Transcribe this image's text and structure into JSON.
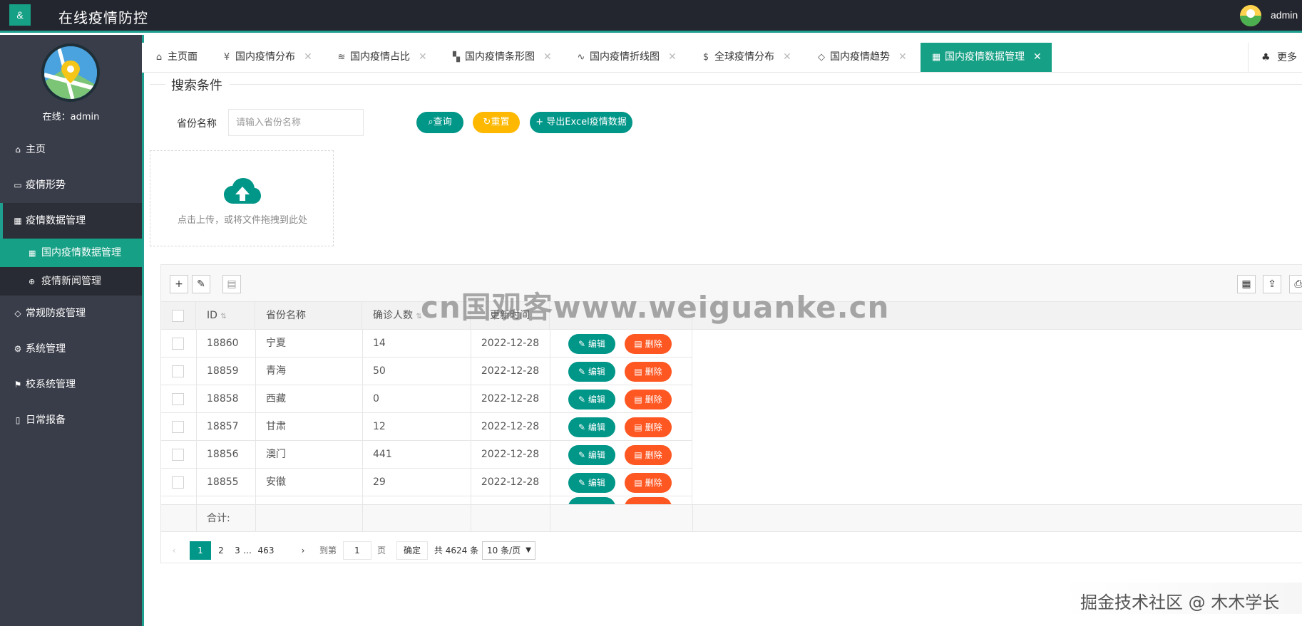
{
  "header": {
    "logo": "&",
    "title": "在线疫情防控",
    "user": "admin"
  },
  "sidebar": {
    "online_text": "在线：admin",
    "items": [
      {
        "icon": "home-icon",
        "glyph": "⌂",
        "label": "主页"
      },
      {
        "icon": "monitor-icon",
        "glyph": "▭",
        "label": "疫情形势"
      },
      {
        "icon": "table-icon",
        "glyph": "▦",
        "label": "疫情数据管理"
      },
      {
        "icon": "shield-icon",
        "glyph": "◇",
        "label": "常规防疫管理"
      },
      {
        "icon": "gear-icon",
        "glyph": "⚙",
        "label": "系统管理"
      },
      {
        "icon": "flag-icon",
        "glyph": "⚑",
        "label": "校系统管理"
      },
      {
        "icon": "book-icon",
        "glyph": "▯",
        "label": "日常报备"
      }
    ],
    "sub_items": [
      {
        "icon": "table-icon",
        "glyph": "▦",
        "label": "国内疫情数据管理"
      },
      {
        "icon": "globe-icon",
        "glyph": "⊕",
        "label": "疫情新闻管理"
      }
    ]
  },
  "tabs": [
    {
      "icon": "home-icon",
      "glyph": "⌂",
      "label": "主页面"
    },
    {
      "icon": "yen-icon",
      "glyph": "¥",
      "label": "国内疫情分布"
    },
    {
      "icon": "layers-icon",
      "glyph": "≋",
      "label": "国内疫情占比"
    },
    {
      "icon": "app-icon",
      "glyph": "▚",
      "label": "国内疫情条形图"
    },
    {
      "icon": "pulse-icon",
      "glyph": "∿",
      "label": "国内疫情折线图"
    },
    {
      "icon": "dollar-icon",
      "glyph": "$",
      "label": "全球疫情分布"
    },
    {
      "icon": "diamond-icon",
      "glyph": "◇",
      "label": "国内疫情趋势"
    },
    {
      "icon": "table-icon",
      "glyph": "▦",
      "label": "国内疫情数据管理"
    }
  ],
  "tab_more": "更多",
  "search": {
    "legend": "搜索条件",
    "field_label": "省份名称",
    "placeholder": "请输入省份名称",
    "query_label": "查询",
    "reset_label": "重置",
    "export_label": "导出Excel疫情数据"
  },
  "upload": {
    "text": "点击上传，或将文件拖拽到此处"
  },
  "table": {
    "headers": {
      "id": "ID",
      "province": "省份名称",
      "confirmed": "确诊人数",
      "updated": "更新时间"
    },
    "rows": [
      {
        "id": "18860",
        "province": "宁夏",
        "confirmed": "14",
        "updated": "2022-12-28"
      },
      {
        "id": "18859",
        "province": "青海",
        "confirmed": "50",
        "updated": "2022-12-28"
      },
      {
        "id": "18858",
        "province": "西藏",
        "confirmed": "0",
        "updated": "2022-12-28"
      },
      {
        "id": "18857",
        "province": "甘肃",
        "confirmed": "12",
        "updated": "2022-12-28"
      },
      {
        "id": "18856",
        "province": "澳门",
        "confirmed": "441",
        "updated": "2022-12-28"
      },
      {
        "id": "18855",
        "province": "安徽",
        "confirmed": "29",
        "updated": "2022-12-28"
      }
    ],
    "edit_label": "编辑",
    "delete_label": "删除",
    "total_label": "合计:"
  },
  "pager": {
    "pages": [
      "1",
      "2",
      "3",
      "…",
      "463"
    ],
    "goto_label": "到第",
    "goto_value": "1",
    "page_unit": "页",
    "confirm_label": "确定",
    "total_text": "共 4624 条",
    "page_size": "10 条/页"
  },
  "watermarks": {
    "center": "cn国观客www.weiguanke.cn",
    "corner": "掘金技术社区 @ 木木学长"
  },
  "colors": {
    "primary": "#009688",
    "warning": "#ffb800",
    "danger": "#ff5722",
    "header_bg": "#23262e",
    "sidebar_bg": "#393d49"
  }
}
